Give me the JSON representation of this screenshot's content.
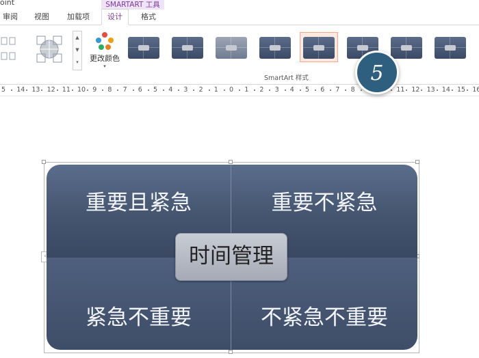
{
  "app": {
    "title_fragment": "oint"
  },
  "ribbon": {
    "contextual_group": "SMARTART 工具",
    "tabs": [
      {
        "label": "审阅"
      },
      {
        "label": "视图"
      },
      {
        "label": "加载项"
      },
      {
        "label": "设计",
        "active": true
      },
      {
        "label": "格式"
      }
    ],
    "change_colors_label": "更改颜色",
    "styles_group_label": "SmartArt 样式",
    "selected_style_index": 5
  },
  "callout": {
    "step_number": "5"
  },
  "ruler": {
    "labels": [
      "5",
      "14",
      "13",
      "12",
      "11",
      "10",
      "9",
      "8",
      "7",
      "6",
      "5",
      "4",
      "3",
      "2",
      "1",
      "0",
      "1",
      "2",
      "3",
      "4",
      "5",
      "6",
      "7",
      "8",
      "",
      "",
      "11",
      "12",
      "13",
      "14",
      "15",
      "16"
    ]
  },
  "diagram": {
    "top_left": "重要且紧急",
    "top_right": "重要不紧急",
    "bottom_left": "紧急不重要",
    "bottom_right": "不紧急不重要",
    "center": "时间管理"
  },
  "colors": {
    "quadrant": "#45556f",
    "center_box": "#b5b9c3",
    "callout": "#2f5f7f",
    "contextual_tab": "#7a3a9a"
  }
}
